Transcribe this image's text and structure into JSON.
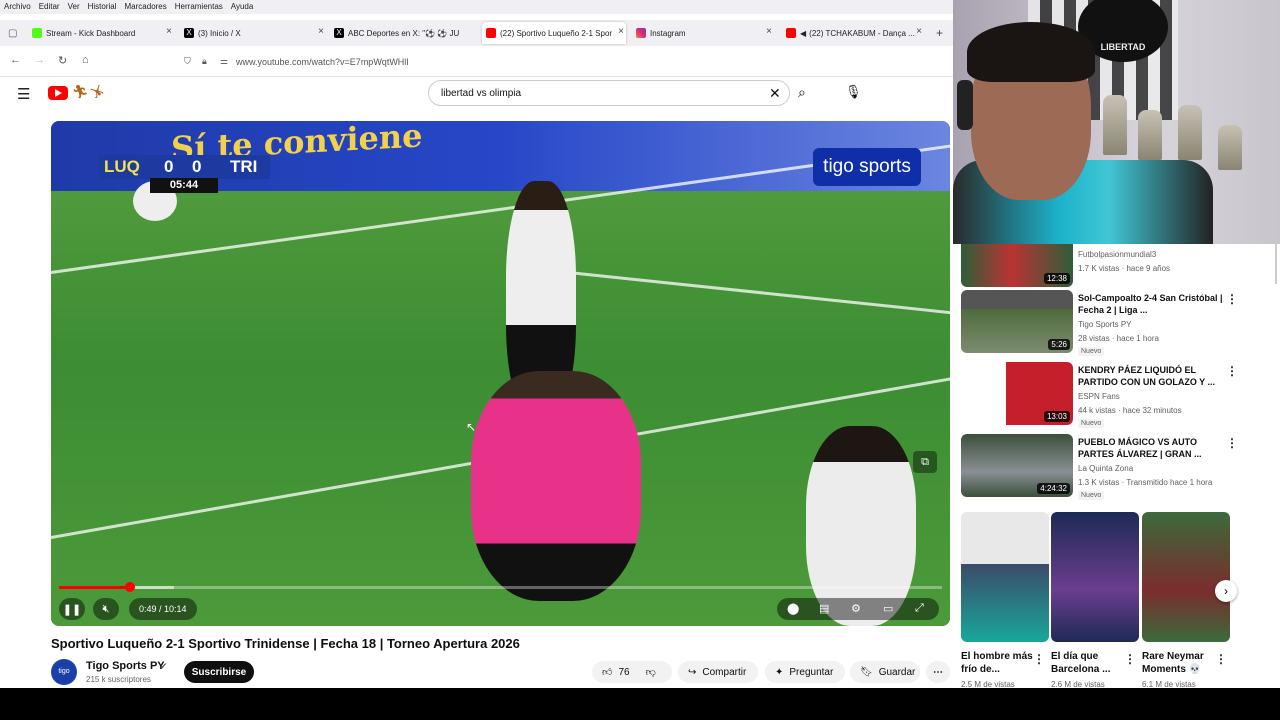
{
  "menu": [
    "Archivo",
    "Editar",
    "Ver",
    "Historial",
    "Marcadores",
    "Herramientas",
    "Ayuda"
  ],
  "tabs": [
    {
      "label": "Stream - Kick Dashboard",
      "color": "#53fc18"
    },
    {
      "label": "(3) Inicio / X",
      "color": "#000000"
    },
    {
      "label": "ABC Deportes en X: \"⚽ ⚽ JU",
      "color": "#000000"
    },
    {
      "label": "(22) Sportivo Luqueño 2-1 Spor",
      "color": "#ff0000"
    },
    {
      "label": "Instagram",
      "color": "#d6249f"
    },
    {
      "label": "(22) TCHAKABUM - Dança ...",
      "color": "#ff0000"
    }
  ],
  "url": "www.youtube.com/watch?v=E7mpWqtWHlI",
  "search": {
    "query": "libertad vs olimpia"
  },
  "video": {
    "banner_text": "Sí te conviene",
    "home_team": "LUQ",
    "away_team": "TRI",
    "home_score": "0",
    "away_score": "0",
    "clock": "05:44",
    "broadcaster": "tigo sports",
    "time": "0:49 / 10:14",
    "progress": 0.08,
    "buffered": 0.13
  },
  "title": "Sportivo Luqueño 2-1 Sportivo Trinidense | Fecha 18 | Torneo Apertura 2026",
  "channel": {
    "name": "Tigo Sports PY",
    "avatar_text": "tigo sports",
    "subs": "215 k suscriptores",
    "subscribe": "Suscribirse",
    "likes": "76",
    "share": "Compartir",
    "ask": "Preguntar",
    "save": "Guardar"
  },
  "recs": [
    {
      "title": "",
      "channel": "Futbolpasionmundial3",
      "meta": "1.7 K vistas · hace 9 años",
      "badge": "",
      "dur": "12:38",
      "colors": [
        "#2f5d3a",
        "#b33"
      ]
    },
    {
      "title": "Sol-Campoalto 2-4 San Cristóbal | Fecha 2 | Liga ...",
      "channel": "Tigo Sports PY",
      "meta": "28 vistas · hace 1 hora",
      "badge": "Nuevo",
      "dur": "5:26",
      "colors": [
        "#4e6b3d",
        "#7d8c70"
      ]
    },
    {
      "title": "KENDRY PÁEZ LIQUIDÓ EL PARTIDO CON UN GOLAZO Y ...",
      "channel": "ESPN Fans",
      "meta": "44 k vistas · hace 32 minutos",
      "badge": "Nuevo",
      "dur": "13:03",
      "colors": [
        "#c41f2a",
        "#ffffff"
      ]
    },
    {
      "title": "PUEBLO MÁGICO VS AUTO PARTES ÁLVAREZ | GRAN ...",
      "channel": "La Quinta Zona",
      "meta": "1.3 K vistas · Transmitido hace 1 hora",
      "badge": "Nuevo",
      "dur": "4:24:32",
      "colors": [
        "#3b4f3a",
        "#8a8f95"
      ]
    }
  ],
  "shorts": [
    {
      "title": "El hombre más frío de...",
      "meta": "2.5 M de vistas",
      "colors": [
        "#3c4a6a",
        "#17a89a"
      ]
    },
    {
      "title": "El día que Barcelona ...",
      "meta": "2.6 M de vistas",
      "colors": [
        "#1d2a55",
        "#6a3e8f"
      ]
    },
    {
      "title": "Rare Neymar Moments 💀",
      "meta": "6.1 M de vistas",
      "colors": [
        "#3b6b3c",
        "#7a2d2d"
      ]
    }
  ],
  "webcam": {
    "flag_text": "LIBERTAD"
  }
}
